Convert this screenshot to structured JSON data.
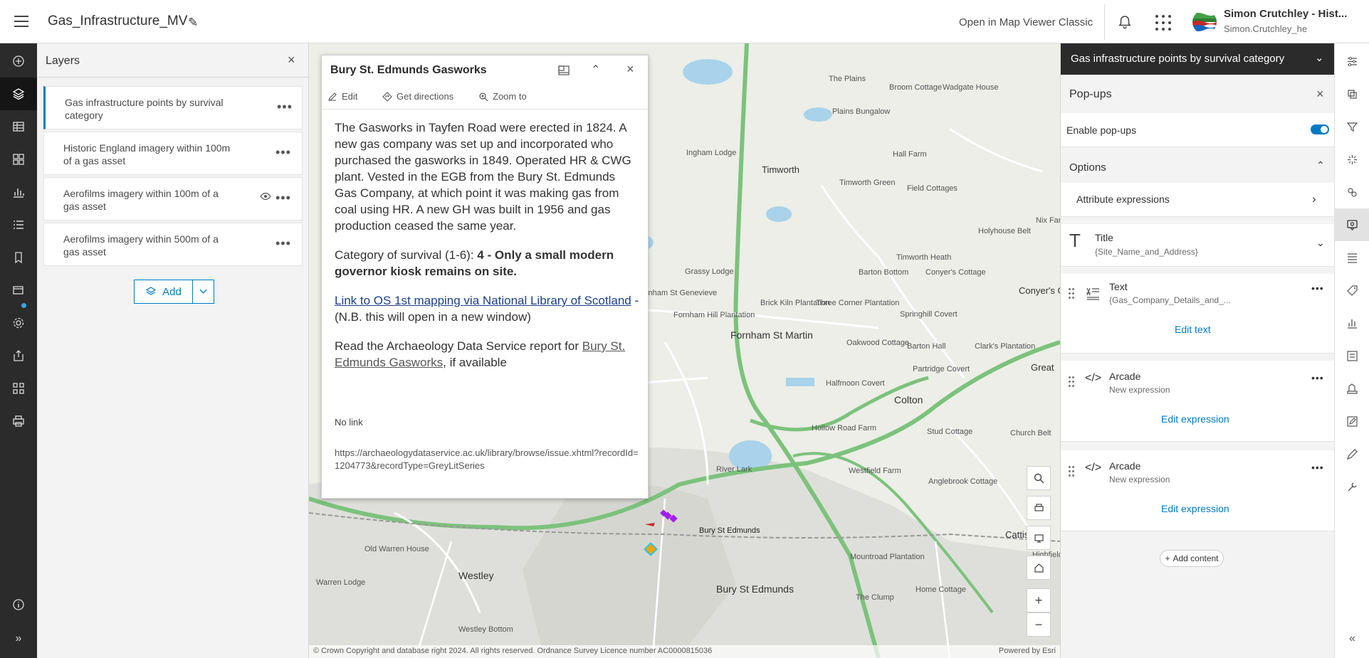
{
  "header": {
    "title": "Gas_Infrastructure_MV",
    "open_classic": "Open in Map Viewer Classic",
    "user_name": "Simon Crutchley - Hist...",
    "user_id": "Simon.Crutchley_he"
  },
  "layers": {
    "title": "Layers",
    "items": [
      {
        "label": "Gas infrastructure points by survival category"
      },
      {
        "label": "Historic England imagery within 100m of a gas asset"
      },
      {
        "label": "Aerofilms imagery within 100m of a gas asset"
      },
      {
        "label": "Aerofilms imagery within 500m of a gas asset"
      }
    ],
    "add_label": "Add"
  },
  "popup": {
    "title": "Bury St. Edmunds Gasworks",
    "actions": {
      "edit": "Edit",
      "directions": "Get directions",
      "zoom": "Zoom to"
    },
    "paragraph1": "The Gasworks in Tayfen Road were erected in 1824. A new gas company was set up and incorporated who purchased the gasworks in 1849. Operated HR & CWG plant. Vested in the EGB from the Bury St. Edmunds Gas Company, at which point it was making gas from coal using HR. A new GH was built in 1956 and gas production ceased the same year.",
    "category_prefix": "Category of survival (1-6): ",
    "category_value": "4 - Only a small modern governor kiosk remains on site.",
    "os_link": "Link to OS 1st mapping via National Library of Scotland",
    "os_note": " - (N.B. this will open in a new window)",
    "ads_prefix": "Read the Archaeology Data Service report for ",
    "ads_link": "Bury St. Edmunds Gasworks",
    "ads_suffix": ", if available",
    "no_link": "No link",
    "url": "https://archaeologydataservice.ac.uk/library/browse/issue.xhtml?recordId=1204773&recordType=GreyLitSeries"
  },
  "map": {
    "attribution": "© Crown Copyright and database right 2024. All rights reserved. Ordnance Survey Licence number AC0000815036",
    "powered": "Powered by Esri",
    "places": [
      "The Plains",
      "Broom Cottage",
      "Wadgate House",
      "Plains Bungalow",
      "Ingham Lodge",
      "Timworth",
      "Hall Farm",
      "Timworth Green",
      "Field Cottages",
      "Grassy Lodge",
      "Fornham St Genevieve",
      "Brick Kiln Plantation",
      "Three Corner Plantation",
      "Barton Bottom",
      "Conyer's Cottage",
      "Conyer's Green",
      "Holyhouse Belt",
      "Timworth Heath",
      "Springhill Covert",
      "Oakwood Cottage",
      "Barton Hall",
      "Clark's Plantation",
      "Fornham St Martin",
      "Halfmoon Covert",
      "Partridge Covert",
      "Colton",
      "Hollow Road Farm",
      "Stud Cottage",
      "Church Belt",
      "Westfield Farm",
      "Anglebrook Cottage",
      "River Lark",
      "Bury St Edmunds",
      "Old Warren House",
      "Westley",
      "Warren Lodge",
      "Mountroad Plantation",
      "The Clump",
      "Home Cottage",
      "Cattisha",
      "Highfield",
      "Westley Bottom",
      "Bury St Edmunds",
      "Great",
      "Nix Farm",
      "Fornham Hill Plantation"
    ]
  },
  "right_panel": {
    "layer_title": "Gas infrastructure points by survival category",
    "popups_title": "Pop-ups",
    "enable_label": "Enable pop-ups",
    "options_label": "Options",
    "attr_expr": "Attribute expressions",
    "title_label": "Title",
    "title_value": "{Site_Name_and_Address}",
    "text_label": "Text",
    "text_value": "{Gas_Company_Details_and_...",
    "edit_text": "Edit text",
    "arcade1_label": "Arcade",
    "arcade1_sub": "New expression",
    "arcade2_label": "Arcade",
    "arcade2_sub": "New expression",
    "edit_expression": "Edit expression",
    "add_content": "Add content"
  }
}
